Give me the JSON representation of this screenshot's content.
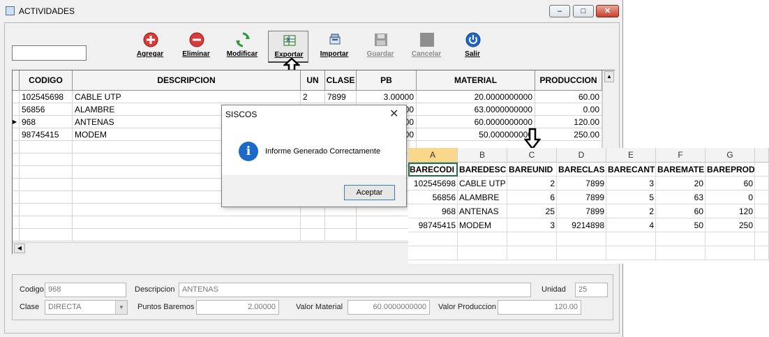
{
  "window": {
    "title": "ACTIVIDADES"
  },
  "toolbar": [
    {
      "label": "Agregar",
      "icon": "add-icon",
      "enabled": true
    },
    {
      "label": "Eliminar",
      "icon": "remove-icon",
      "enabled": true
    },
    {
      "label": "Modificar",
      "icon": "refresh-icon",
      "enabled": true
    },
    {
      "label": "Exportar",
      "icon": "excel-export-icon",
      "enabled": true
    },
    {
      "label": "Importar",
      "icon": "import-icon",
      "enabled": true
    },
    {
      "label": "Guardar",
      "icon": "save-icon",
      "enabled": false
    },
    {
      "label": "Cancelar",
      "icon": "cancel-icon",
      "enabled": false
    },
    {
      "label": "Salir",
      "icon": "power-icon",
      "enabled": true
    }
  ],
  "grid": {
    "columns": [
      "CODIGO",
      "DESCRIPCION",
      "UN",
      "CLASE",
      "PB",
      "MATERIAL",
      "PRODUCCION"
    ],
    "rows": [
      [
        "102545698",
        "CABLE UTP",
        "2",
        "7899",
        "3.00000",
        "20.0000000000",
        "60.00"
      ],
      [
        "56856",
        "ALAMBRE",
        "",
        "",
        "00",
        "63.0000000000",
        "0.00"
      ],
      [
        "968",
        "ANTENAS",
        "",
        "",
        "00",
        "60.0000000000",
        "120.00"
      ],
      [
        "98745415",
        "MODEM",
        "",
        "",
        "00",
        "50.000000000",
        "250.00"
      ]
    ],
    "current_row": 2
  },
  "dialog": {
    "title": "SISCOS",
    "message": "Informe Generado Correctamente",
    "ok_label": "Aceptar"
  },
  "excel": {
    "columns": [
      "A",
      "B",
      "C",
      "D",
      "E",
      "F",
      "G"
    ],
    "header": [
      "BARECODI",
      "BAREDESC",
      "BAREUNID",
      "BARECLAS",
      "BARECANT",
      "BAREMATE",
      "BAREPROD"
    ],
    "rows": [
      [
        "102545698",
        "CABLE UTP",
        "2",
        "7899",
        "3",
        "20",
        "60"
      ],
      [
        "56856",
        "ALAMBRE",
        "6",
        "7899",
        "5",
        "63",
        "0"
      ],
      [
        "968",
        "ANTENAS",
        "25",
        "7899",
        "2",
        "60",
        "120"
      ],
      [
        "98745415",
        "MODEM",
        "3",
        "9214898",
        "4",
        "50",
        "250"
      ]
    ]
  },
  "form": {
    "codigo_label": "Codigo",
    "codigo_value": "968",
    "descripcion_label": "Descripcion",
    "descripcion_value": "ANTENAS",
    "unidad_label": "Unidad",
    "unidad_value": "25",
    "clase_label": "Clase",
    "clase_value": "DIRECTA",
    "puntos_label": "Puntos Baremos",
    "puntos_value": "2.00000",
    "material_label": "Valor Material",
    "material_value": "60.0000000000",
    "produccion_label": "Valor Produccion",
    "produccion_value": "120.00"
  }
}
